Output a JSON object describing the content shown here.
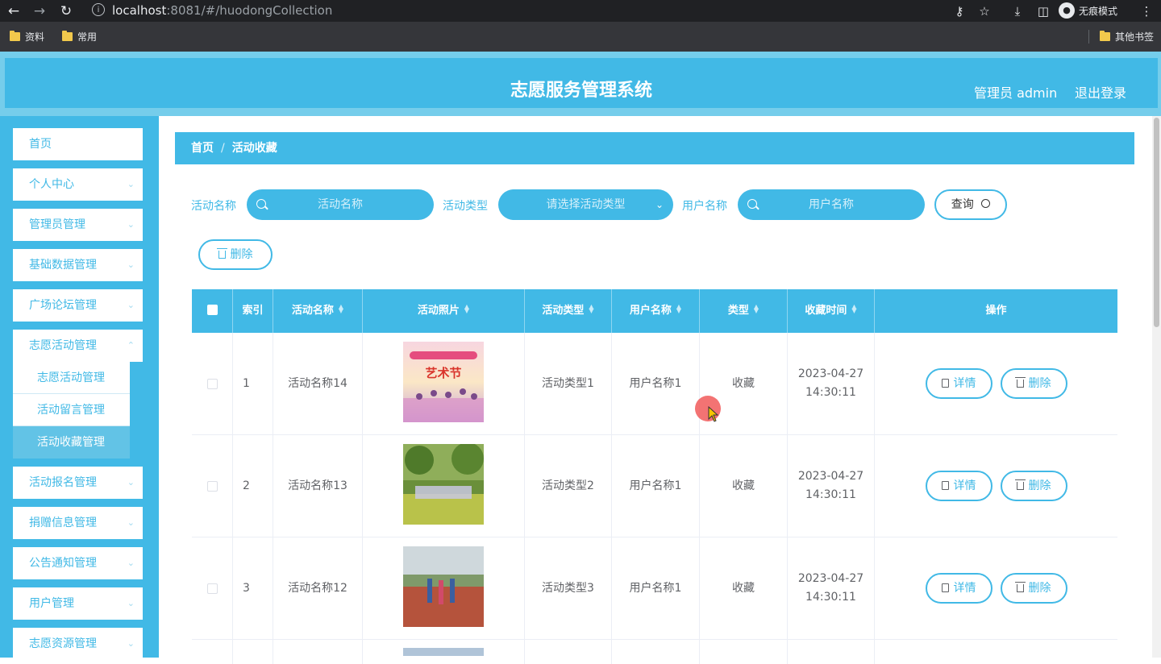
{
  "browser": {
    "url_host": "localhost",
    "url_rest": ":8081/#/huodongCollection",
    "incognito_label": "无痕模式",
    "bookmarks": [
      "资料",
      "常用"
    ],
    "other_bookmarks": "其他书签"
  },
  "header": {
    "title": "志愿服务管理系统",
    "admin_label": "管理员 admin",
    "logout_label": "退出登录"
  },
  "sidebar": {
    "items": [
      {
        "label": "首页"
      },
      {
        "label": "个人中心"
      },
      {
        "label": "管理员管理"
      },
      {
        "label": "基础数据管理"
      },
      {
        "label": "广场论坛管理"
      },
      {
        "label": "志愿活动管理"
      },
      {
        "label": "活动报名管理"
      },
      {
        "label": "捐赠信息管理"
      },
      {
        "label": "公告通知管理"
      },
      {
        "label": "用户管理"
      },
      {
        "label": "志愿资源管理"
      }
    ],
    "subitems": [
      {
        "label": "志愿活动管理"
      },
      {
        "label": "活动留言管理"
      },
      {
        "label": "活动收藏管理"
      }
    ]
  },
  "breadcrumb": {
    "home": "首页",
    "current": "活动收藏"
  },
  "filters": {
    "name_label": "活动名称",
    "name_placeholder": "活动名称",
    "type_label": "活动类型",
    "type_placeholder": "请选择活动类型",
    "user_label": "用户名称",
    "user_placeholder": "用户名称",
    "query_label": "查询",
    "delete_label": "删除"
  },
  "table": {
    "headers": {
      "index": "索引",
      "name": "活动名称",
      "photo": "活动照片",
      "type": "活动类型",
      "user": "用户名称",
      "kind": "类型",
      "time": "收藏时间",
      "ops": "操作"
    },
    "rows": [
      {
        "index": "1",
        "name": "活动名称14",
        "type": "活动类型1",
        "user": "用户名称1",
        "kind": "收藏",
        "date": "2023-04-27",
        "time": "14:30:11",
        "photo_text": "艺术节"
      },
      {
        "index": "2",
        "name": "活动名称13",
        "type": "活动类型2",
        "user": "用户名称1",
        "kind": "收藏",
        "date": "2023-04-27",
        "time": "14:30:11"
      },
      {
        "index": "3",
        "name": "活动名称12",
        "type": "活动类型3",
        "user": "用户名称1",
        "kind": "收藏",
        "date": "2023-04-27",
        "time": "14:30:11"
      }
    ],
    "detail_label": "详情",
    "delete_label": "删除"
  },
  "colors": {
    "accent": "#41b9e6",
    "header_outer": "#75cdeb",
    "active_sub": "#62c3e6"
  }
}
